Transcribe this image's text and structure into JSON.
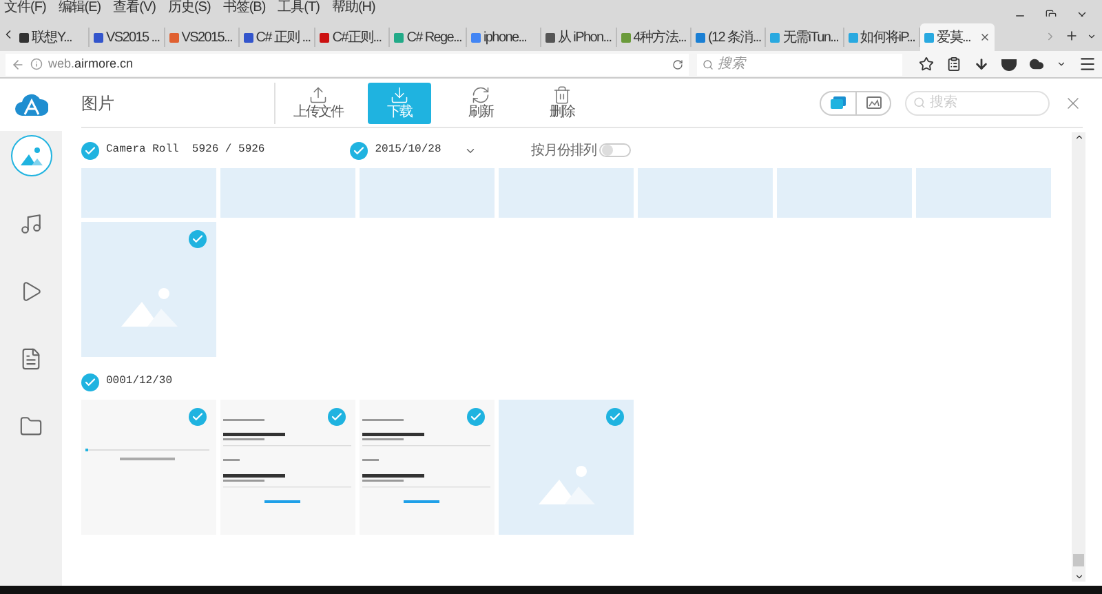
{
  "menu_bar": [
    "文件(F)",
    "编辑(E)",
    "查看(V)",
    "历史(S)",
    "书签(B)",
    "工具(T)",
    "帮助(H)"
  ],
  "tabs": [
    {
      "label": "联想Y...",
      "selected": false,
      "color": "#333333"
    },
    {
      "label": "VS2015 ...",
      "selected": false,
      "color": "#3355cc"
    },
    {
      "label": "VS2015...",
      "selected": false,
      "color": "#e06030"
    },
    {
      "label": "C# 正则 ...",
      "selected": false,
      "color": "#3355cc"
    },
    {
      "label": "C#正则...",
      "selected": false,
      "color": "#cc1111"
    },
    {
      "label": "C# Rege...",
      "selected": false,
      "color": "#22aa88"
    },
    {
      "label": "iphone...",
      "selected": false,
      "color": "#4285f4"
    },
    {
      "label": "从 iPhon...",
      "selected": false,
      "color": "#555555"
    },
    {
      "label": "4种方法...",
      "selected": false,
      "color": "#6a9a3a"
    },
    {
      "label": "(12 条消...",
      "selected": false,
      "color": "#1a7fd4"
    },
    {
      "label": "无需iTun...",
      "selected": false,
      "color": "#29a9e0"
    },
    {
      "label": "如何将iP...",
      "selected": false,
      "color": "#29a9e0"
    },
    {
      "label": "爱莫...",
      "selected": true,
      "color": "#29a9e0"
    }
  ],
  "address": {
    "url_host": "web.",
    "url_domain": "airmore.cn"
  },
  "browser_search": {
    "placeholder": "搜索"
  },
  "app": {
    "title": "图片",
    "sidebar": [
      {
        "kind": "photos",
        "selected": true
      },
      {
        "kind": "music",
        "selected": false
      },
      {
        "kind": "video",
        "selected": false
      },
      {
        "kind": "documents",
        "selected": false
      },
      {
        "kind": "files",
        "selected": false
      }
    ],
    "toolbar": [
      {
        "kind": "upload",
        "label": "上传文件",
        "selected": false
      },
      {
        "kind": "download",
        "label": "下载",
        "selected": true
      },
      {
        "kind": "refresh",
        "label": "刷新",
        "selected": false
      },
      {
        "kind": "delete",
        "label": "删除",
        "selected": false
      }
    ],
    "view_modes": [
      {
        "kind": "stack",
        "selected": true
      },
      {
        "kind": "preview",
        "selected": false
      }
    ],
    "search": {
      "placeholder": "搜索"
    }
  },
  "groups": [
    {
      "title": "Camera Roll",
      "count": "5926 / 5926",
      "checked": true,
      "date": {
        "label": "2015/10/28",
        "checked": true
      },
      "sort": {
        "label": "按月份排列",
        "on": false
      },
      "tiles": [
        {
          "kind": "cropped"
        },
        {
          "kind": "cropped"
        },
        {
          "kind": "cropped"
        },
        {
          "kind": "cropped"
        },
        {
          "kind": "cropped"
        },
        {
          "kind": "cropped"
        },
        {
          "kind": "cropped"
        },
        {
          "kind": "placeholder",
          "checked": true
        }
      ]
    },
    {
      "title": "0001/12/30",
      "checked": true,
      "tiles": [
        {
          "kind": "progress-screen",
          "checked": true
        },
        {
          "kind": "backup-screen",
          "checked": true
        },
        {
          "kind": "backup-screen",
          "checked": true
        },
        {
          "kind": "placeholder",
          "checked": true
        }
      ]
    }
  ]
}
